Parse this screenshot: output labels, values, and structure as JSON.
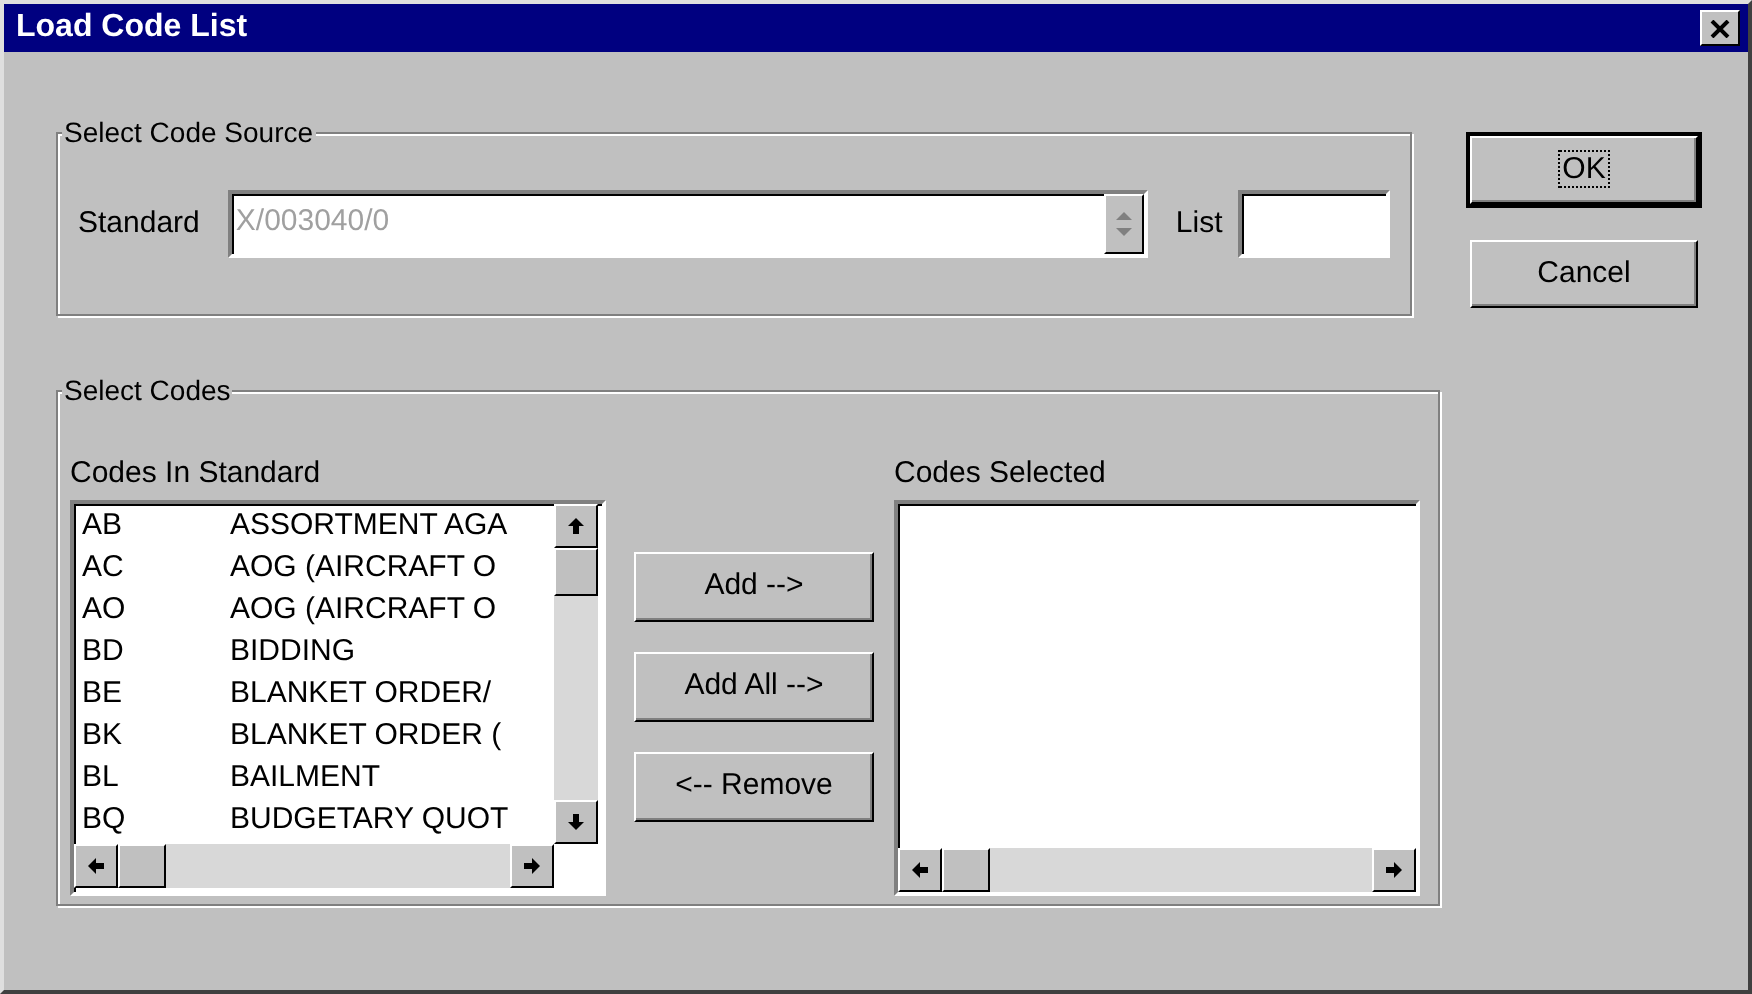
{
  "window": {
    "title": "Load Code List"
  },
  "code_source": {
    "title": "Select Code Source",
    "standard_label": "Standard",
    "standard_value": "X/003040/0",
    "standard_disabled": true,
    "list_label": "List"
  },
  "dialog_buttons": [
    {
      "label": "OK",
      "default": true
    },
    {
      "label": "Cancel",
      "default": false
    }
  ],
  "select_codes": {
    "title": "Select Codes",
    "codes_in_standard": {
      "label": "Codes In Standard",
      "items": [
        {
          "code": "AB",
          "description": "ASSORTMENT AGA"
        },
        {
          "code": "AC",
          "description": "AOG (AIRCRAFT O"
        },
        {
          "code": "AO",
          "description": "AOG (AIRCRAFT O"
        },
        {
          "code": "BD",
          "description": "BIDDING"
        },
        {
          "code": "BE",
          "description": "BLANKET ORDER/"
        },
        {
          "code": "BK",
          "description": "BLANKET ORDER ("
        },
        {
          "code": "BL",
          "description": "BAILMENT"
        },
        {
          "code": "BQ",
          "description": "BUDGETARY QUOT"
        }
      ]
    },
    "move_buttons": [
      "Add -->",
      "Add All -->",
      "<-- Remove"
    ],
    "codes_selected": {
      "label": "Codes Selected"
    }
  }
}
